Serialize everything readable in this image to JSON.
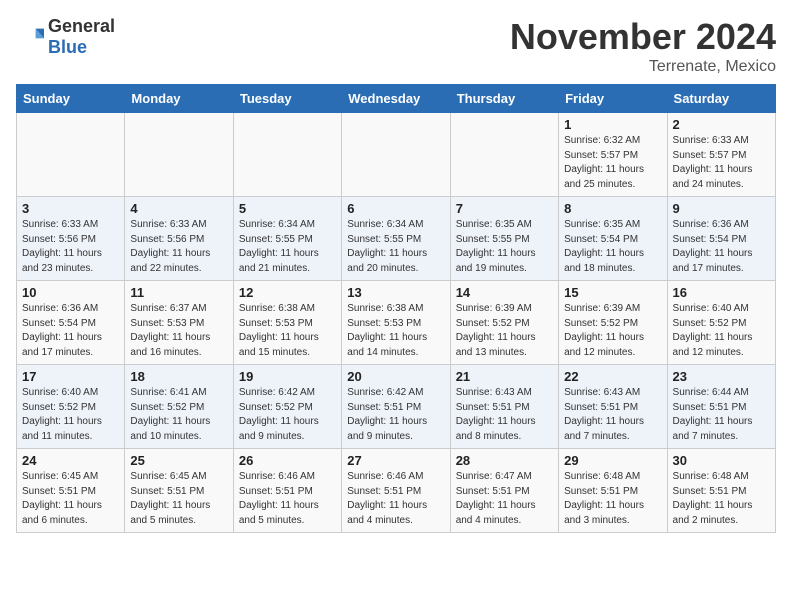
{
  "logo": {
    "general": "General",
    "blue": "Blue"
  },
  "title": "November 2024",
  "location": "Terrenate, Mexico",
  "days_of_week": [
    "Sunday",
    "Monday",
    "Tuesday",
    "Wednesday",
    "Thursday",
    "Friday",
    "Saturday"
  ],
  "weeks": [
    [
      {
        "day": "",
        "info": ""
      },
      {
        "day": "",
        "info": ""
      },
      {
        "day": "",
        "info": ""
      },
      {
        "day": "",
        "info": ""
      },
      {
        "day": "",
        "info": ""
      },
      {
        "day": "1",
        "info": "Sunrise: 6:32 AM\nSunset: 5:57 PM\nDaylight: 11 hours and 25 minutes."
      },
      {
        "day": "2",
        "info": "Sunrise: 6:33 AM\nSunset: 5:57 PM\nDaylight: 11 hours and 24 minutes."
      }
    ],
    [
      {
        "day": "3",
        "info": "Sunrise: 6:33 AM\nSunset: 5:56 PM\nDaylight: 11 hours and 23 minutes."
      },
      {
        "day": "4",
        "info": "Sunrise: 6:33 AM\nSunset: 5:56 PM\nDaylight: 11 hours and 22 minutes."
      },
      {
        "day": "5",
        "info": "Sunrise: 6:34 AM\nSunset: 5:55 PM\nDaylight: 11 hours and 21 minutes."
      },
      {
        "day": "6",
        "info": "Sunrise: 6:34 AM\nSunset: 5:55 PM\nDaylight: 11 hours and 20 minutes."
      },
      {
        "day": "7",
        "info": "Sunrise: 6:35 AM\nSunset: 5:55 PM\nDaylight: 11 hours and 19 minutes."
      },
      {
        "day": "8",
        "info": "Sunrise: 6:35 AM\nSunset: 5:54 PM\nDaylight: 11 hours and 18 minutes."
      },
      {
        "day": "9",
        "info": "Sunrise: 6:36 AM\nSunset: 5:54 PM\nDaylight: 11 hours and 17 minutes."
      }
    ],
    [
      {
        "day": "10",
        "info": "Sunrise: 6:36 AM\nSunset: 5:54 PM\nDaylight: 11 hours and 17 minutes."
      },
      {
        "day": "11",
        "info": "Sunrise: 6:37 AM\nSunset: 5:53 PM\nDaylight: 11 hours and 16 minutes."
      },
      {
        "day": "12",
        "info": "Sunrise: 6:38 AM\nSunset: 5:53 PM\nDaylight: 11 hours and 15 minutes."
      },
      {
        "day": "13",
        "info": "Sunrise: 6:38 AM\nSunset: 5:53 PM\nDaylight: 11 hours and 14 minutes."
      },
      {
        "day": "14",
        "info": "Sunrise: 6:39 AM\nSunset: 5:52 PM\nDaylight: 11 hours and 13 minutes."
      },
      {
        "day": "15",
        "info": "Sunrise: 6:39 AM\nSunset: 5:52 PM\nDaylight: 11 hours and 12 minutes."
      },
      {
        "day": "16",
        "info": "Sunrise: 6:40 AM\nSunset: 5:52 PM\nDaylight: 11 hours and 12 minutes."
      }
    ],
    [
      {
        "day": "17",
        "info": "Sunrise: 6:40 AM\nSunset: 5:52 PM\nDaylight: 11 hours and 11 minutes."
      },
      {
        "day": "18",
        "info": "Sunrise: 6:41 AM\nSunset: 5:52 PM\nDaylight: 11 hours and 10 minutes."
      },
      {
        "day": "19",
        "info": "Sunrise: 6:42 AM\nSunset: 5:52 PM\nDaylight: 11 hours and 9 minutes."
      },
      {
        "day": "20",
        "info": "Sunrise: 6:42 AM\nSunset: 5:51 PM\nDaylight: 11 hours and 9 minutes."
      },
      {
        "day": "21",
        "info": "Sunrise: 6:43 AM\nSunset: 5:51 PM\nDaylight: 11 hours and 8 minutes."
      },
      {
        "day": "22",
        "info": "Sunrise: 6:43 AM\nSunset: 5:51 PM\nDaylight: 11 hours and 7 minutes."
      },
      {
        "day": "23",
        "info": "Sunrise: 6:44 AM\nSunset: 5:51 PM\nDaylight: 11 hours and 7 minutes."
      }
    ],
    [
      {
        "day": "24",
        "info": "Sunrise: 6:45 AM\nSunset: 5:51 PM\nDaylight: 11 hours and 6 minutes."
      },
      {
        "day": "25",
        "info": "Sunrise: 6:45 AM\nSunset: 5:51 PM\nDaylight: 11 hours and 5 minutes."
      },
      {
        "day": "26",
        "info": "Sunrise: 6:46 AM\nSunset: 5:51 PM\nDaylight: 11 hours and 5 minutes."
      },
      {
        "day": "27",
        "info": "Sunrise: 6:46 AM\nSunset: 5:51 PM\nDaylight: 11 hours and 4 minutes."
      },
      {
        "day": "28",
        "info": "Sunrise: 6:47 AM\nSunset: 5:51 PM\nDaylight: 11 hours and 4 minutes."
      },
      {
        "day": "29",
        "info": "Sunrise: 6:48 AM\nSunset: 5:51 PM\nDaylight: 11 hours and 3 minutes."
      },
      {
        "day": "30",
        "info": "Sunrise: 6:48 AM\nSunset: 5:51 PM\nDaylight: 11 hours and 2 minutes."
      }
    ]
  ]
}
